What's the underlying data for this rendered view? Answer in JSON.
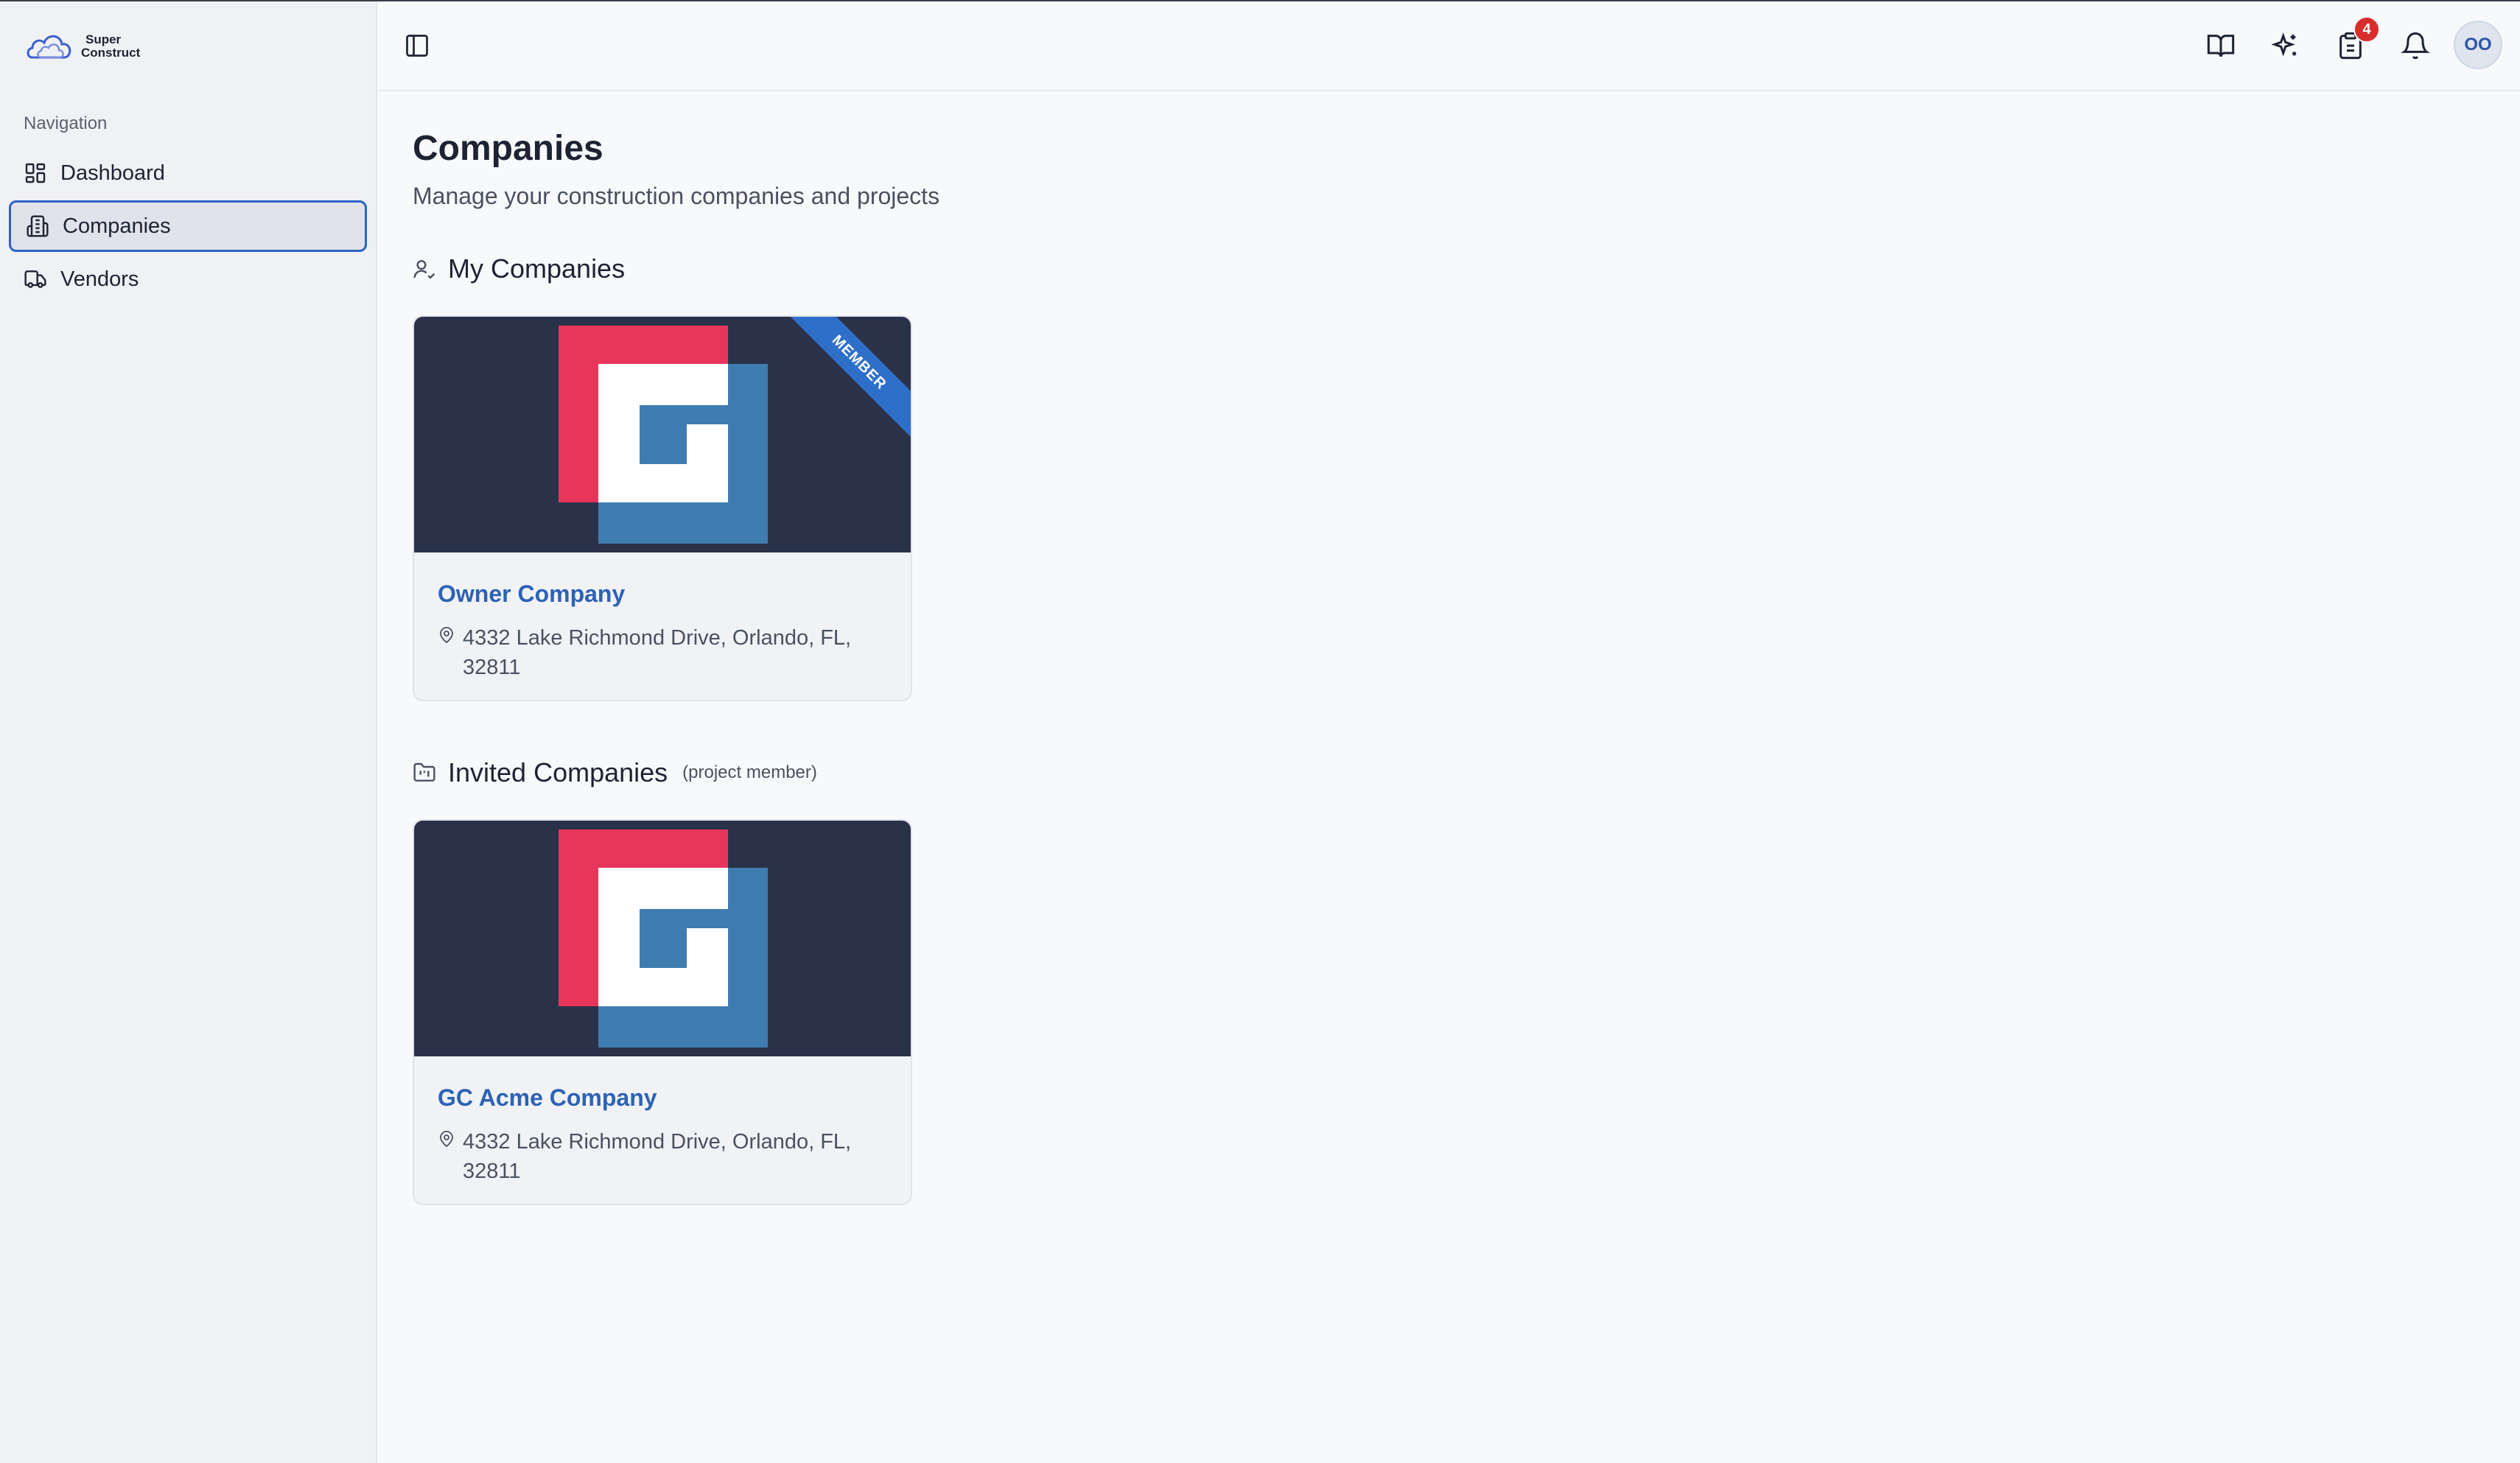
{
  "app": {
    "logo_line1": "Super",
    "logo_line2": "Construct"
  },
  "sidebar": {
    "heading": "Navigation",
    "items": [
      {
        "label": "Dashboard",
        "icon": "dashboard-icon",
        "active": false
      },
      {
        "label": "Companies",
        "icon": "building-icon",
        "active": true
      },
      {
        "label": "Vendors",
        "icon": "truck-icon",
        "active": false
      }
    ]
  },
  "header": {
    "icons": [
      "sidebar-toggle-icon",
      "book-icon",
      "sparkle-icon",
      "clipboard-icon",
      "bell-icon"
    ],
    "task_count": "4",
    "avatar_initials": "OO"
  },
  "page": {
    "title": "Companies",
    "subtitle": "Manage your construction companies and projects"
  },
  "my_companies": {
    "title": "My Companies",
    "cards": [
      {
        "name": "Owner Company",
        "address": "4332 Lake Richmond Drive, Orlando, FL, 32811",
        "ribbon": "MEMBER"
      }
    ]
  },
  "invited_companies": {
    "title": "Invited Companies",
    "note": "(project member)",
    "cards": [
      {
        "name": "GC Acme Company",
        "address": "4332 Lake Richmond Drive, Orlando, FL, 32811"
      }
    ]
  },
  "colors": {
    "accent": "#2d62c7",
    "banner_bg": "#2a324a",
    "logo_red": "#e8365a",
    "logo_blue": "#3f7cb0",
    "badge_red": "#d92d2d"
  }
}
